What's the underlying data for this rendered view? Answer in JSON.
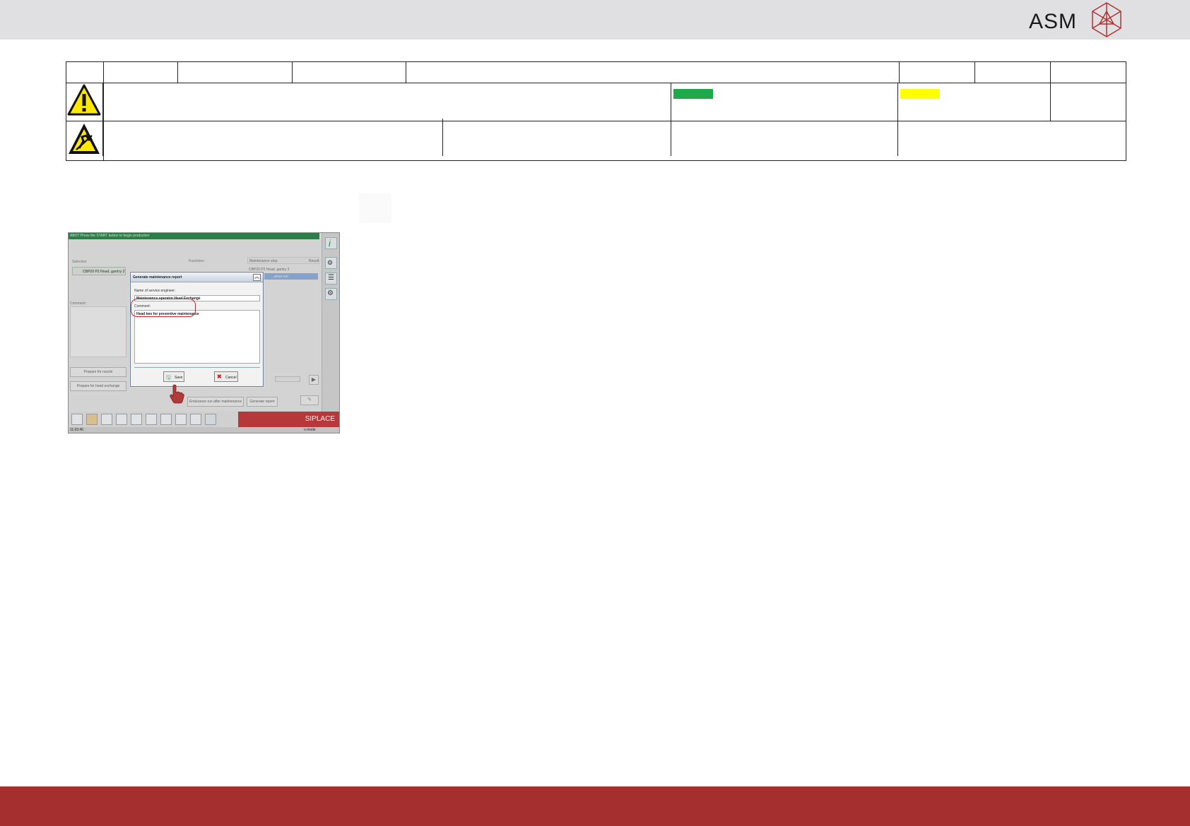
{
  "brand": {
    "name": "ASM",
    "colors": {
      "footer": "#a52e2e",
      "header": "#e0e0e2",
      "warning_green": "#1eaa4a",
      "warning_yellow": "#ffff00"
    }
  },
  "header_table": {
    "icons": [
      "warning-triangle-icon",
      "esd-sensitive-icon"
    ]
  },
  "screenshot": {
    "status_message": "ABOT Press the START button to begin production",
    "selection": {
      "label": "Selection",
      "item": "CBP20 P2 Head, gantry 2"
    },
    "functions_label": "Functions",
    "maintenance_step": {
      "label": "Maintenance step",
      "result_label": "Result",
      "row": "CBP20 P2 Head, gantry 2",
      "row_selected": "...ance run"
    },
    "comment_label": "Comment:",
    "buttons": {
      "prepare_nozzle": "Prepare for nozzle",
      "prepare_head": "Prepare for head exchange",
      "endurance_run": "Endurance run after maintenance",
      "generate_report": "Generate report"
    },
    "brand_label": "SIPLACE",
    "status_bar": {
      "time": "11:03:40",
      "mode": "o mode"
    },
    "dialog": {
      "title": "Generate maintenance report",
      "engineer_label": "Name of service engineer:",
      "engineer_value": "Maintenance operator Head Exchange",
      "comment_label": "Comment:",
      "comment_value": "Head two for preventive maintenance",
      "save_label": "Save",
      "cancel_label": "Cancel"
    }
  }
}
